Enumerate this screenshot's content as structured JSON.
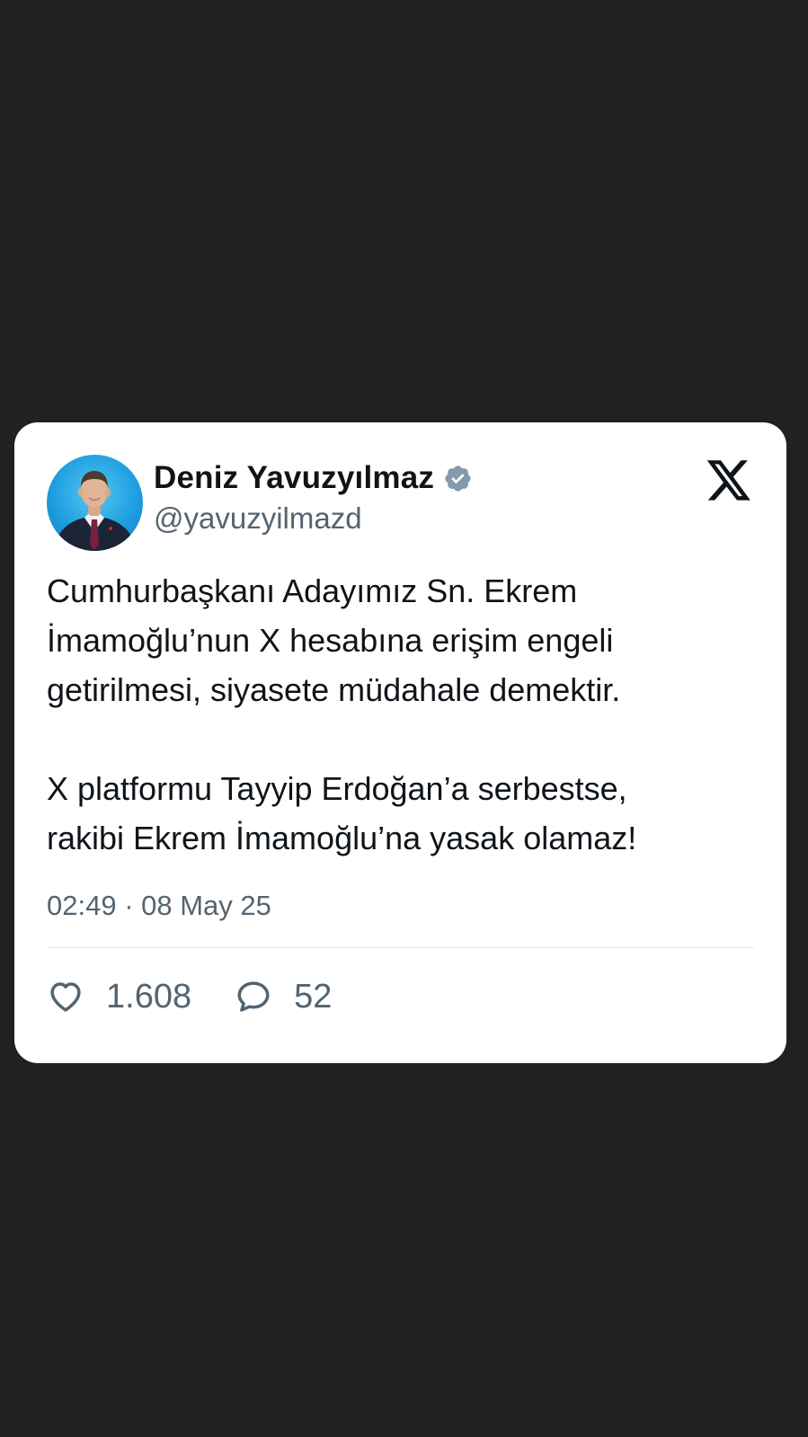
{
  "tweet": {
    "author": {
      "display_name": "Deniz Yavuzyılmaz",
      "handle": "@yavuzyilmazd",
      "verified": true,
      "verified_badge_color": "#829aab"
    },
    "logo": "x-logo-icon",
    "text": "Cumhurbaşkanı Adayımız Sn. Ekrem\nİmamoğlu’nun X hesabına erişim engeli\ngetirilmesi, siyasete müdahale demektir.\n\nX platformu Tayyip Erdoğan’a serbestse,\nrakibi Ekrem İmamoğlu’na yasak olamaz!",
    "timestamp": "02:49 · 08 May 25",
    "stats": {
      "likes": {
        "icon": "heart-icon",
        "count": "1.608"
      },
      "replies": {
        "icon": "reply-bubble-icon",
        "count": "52"
      }
    }
  },
  "colors": {
    "background": "#212121",
    "card": "#ffffff",
    "text_primary": "#0f1419",
    "text_secondary": "#536471"
  }
}
